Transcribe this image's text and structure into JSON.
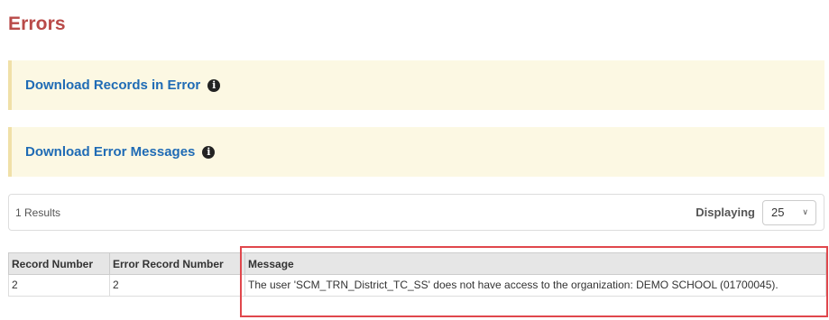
{
  "page": {
    "title": "Errors"
  },
  "downloads": [
    {
      "label": "Download Records in Error",
      "icon": "info-icon"
    },
    {
      "label": "Download Error Messages",
      "icon": "info-icon"
    }
  ],
  "results": {
    "count_text": "1 Results",
    "display_label": "Displaying",
    "page_size": "25"
  },
  "table": {
    "headers": [
      "Record Number",
      "Error Record Number",
      "Message"
    ],
    "rows": [
      {
        "record_number": "2",
        "error_record_number": "2",
        "message": "The user 'SCM_TRN_District_TC_SS' does not have access to the organization: DEMO SCHOOL (01700045)."
      }
    ]
  },
  "colors": {
    "title": "#b94a48",
    "link": "#1f6bb5",
    "callout_bg": "#fcf8e3",
    "highlight": "#e0474c"
  }
}
